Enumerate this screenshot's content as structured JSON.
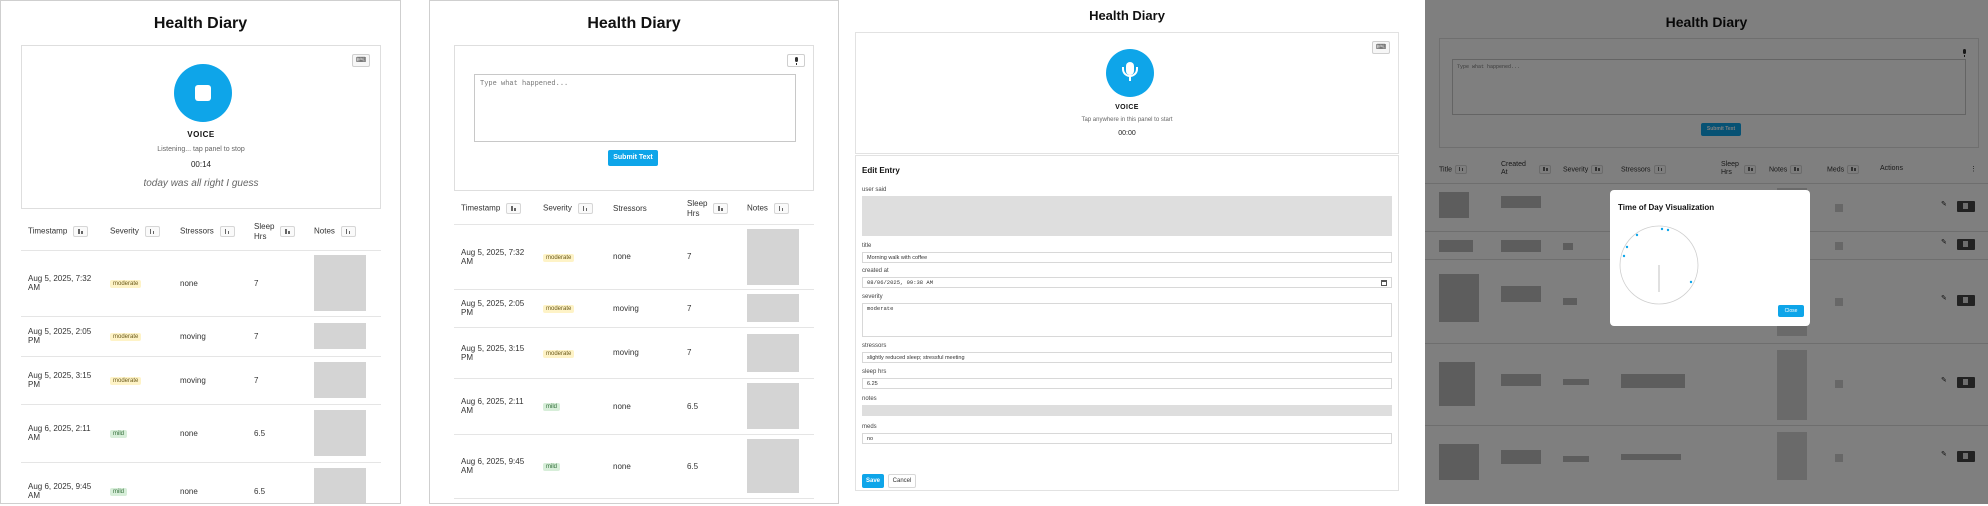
{
  "app_title": "Health Diary",
  "voice": {
    "label": "VOICE",
    "listening_status": "Listening... tap panel to stop",
    "listening_timer": "00:14",
    "transcript": "today was all right I guess",
    "idle_status": "Tap anywhere in this panel to start",
    "idle_timer": "00:00"
  },
  "text_entry": {
    "placeholder": "Type what happened...",
    "submit_label": "Submit Text"
  },
  "table": {
    "columns": {
      "timestamp": "Timestamp",
      "severity": "Severity",
      "stressors": "Stressors",
      "sleep_hrs_line1": "Sleep",
      "sleep_hrs_line2": "Hrs",
      "notes": "Notes"
    },
    "rows": [
      {
        "timestamp": "Aug 5, 2025, 7:32 AM",
        "severity": "moderate",
        "stressors": "none",
        "sleep": "7"
      },
      {
        "timestamp": "Aug 5, 2025, 2:05 PM",
        "severity": "moderate",
        "stressors": "moving",
        "sleep": "7"
      },
      {
        "timestamp": "Aug 5, 2025, 3:15 PM",
        "severity": "moderate",
        "stressors": "moving",
        "sleep": "7"
      },
      {
        "timestamp": "Aug 6, 2025, 2:11 AM",
        "severity": "mild",
        "stressors": "none",
        "sleep": "6.5"
      },
      {
        "timestamp": "Aug 6, 2025, 9:45 AM",
        "severity": "mild",
        "stressors": "none",
        "sleep": "6.5"
      }
    ]
  },
  "edit_entry": {
    "title": "Edit Entry",
    "labels": {
      "user_said": "user said",
      "title": "title",
      "created_at": "created at",
      "severity": "severity",
      "stressors": "stressors",
      "sleep_hrs": "sleep hrs",
      "notes": "notes",
      "meds": "meds"
    },
    "values": {
      "title": "Morning walk with coffee",
      "created_at": "08/06/2025, 09:38 AM",
      "severity": "moderate",
      "stressors": "slightly reduced sleep; stressful meeting",
      "sleep_hrs": "6.25",
      "meds": "no"
    },
    "save_label": "Save",
    "cancel_label": "Cancel"
  },
  "grid": {
    "columns": {
      "title": "Title",
      "created_line1": "Created",
      "created_line2": "At",
      "severity": "Severity",
      "stressors": "Stressors",
      "sleep_line1": "Sleep",
      "sleep_line2": "Hrs",
      "notes": "Notes",
      "meds": "Meds",
      "actions": "Actions"
    }
  },
  "modal": {
    "title": "Time of Day Visualization",
    "close_label": "Close"
  },
  "colors": {
    "accent": "#0ea5e9",
    "moderate_badge": "#fef3c7",
    "mild_badge": "#d7eed9"
  }
}
